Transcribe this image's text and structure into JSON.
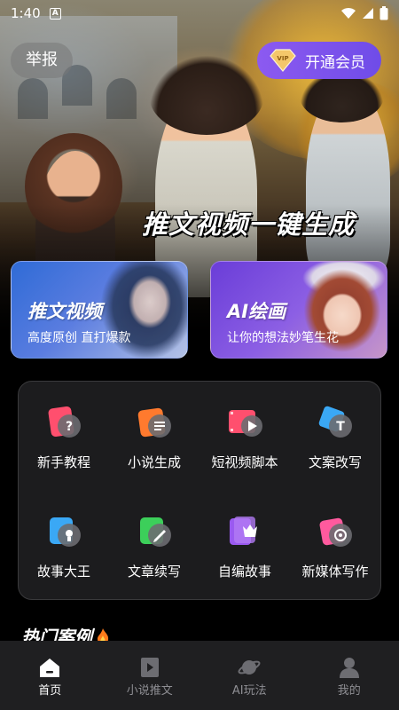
{
  "status_bar": {
    "time": "1:40",
    "indicator": "A"
  },
  "header": {
    "report_label": "举报",
    "vip_label": "开通会员",
    "vip_badge": "VIP"
  },
  "hero": {
    "headline": "推文视频一键生成"
  },
  "feature_cards": [
    {
      "title": "推文视频",
      "subtitle": "高度原创 直打爆款"
    },
    {
      "title": "AI绘画",
      "subtitle": "让你的想法妙笔生花"
    }
  ],
  "tools": [
    {
      "label": "新手教程",
      "icon": "tutorial-icon",
      "color": "#ff4f6e"
    },
    {
      "label": "小说生成",
      "icon": "novel-icon",
      "color": "#ff7a2e"
    },
    {
      "label": "短视频脚本",
      "icon": "video-script-icon",
      "color": "#ff4f6e"
    },
    {
      "label": "文案改写",
      "icon": "rewrite-icon",
      "color": "#3aa8f5"
    },
    {
      "label": "故事大王",
      "icon": "story-icon",
      "color": "#3aa8f5"
    },
    {
      "label": "文章续写",
      "icon": "continue-icon",
      "color": "#3ccf5a"
    },
    {
      "label": "自编故事",
      "icon": "custom-story-icon",
      "color": "#9a5af0"
    },
    {
      "label": "新媒体写作",
      "icon": "media-writing-icon",
      "color": "#ff5a9e"
    }
  ],
  "hot_section": {
    "title": "热门案例"
  },
  "bottom_nav": [
    {
      "label": "首页",
      "icon": "home-icon",
      "active": true
    },
    {
      "label": "小说推文",
      "icon": "novel-tweet-icon",
      "active": false
    },
    {
      "label": "AI玩法",
      "icon": "planet-icon",
      "active": false
    },
    {
      "label": "我的",
      "icon": "profile-icon",
      "active": false
    }
  ]
}
